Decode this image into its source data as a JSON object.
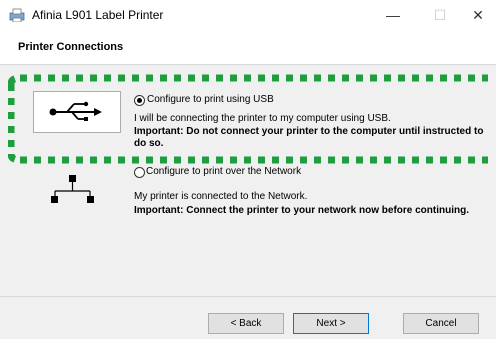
{
  "window": {
    "title": "Afinia L901 Label Printer",
    "controls": {
      "minimize": "—",
      "maximize": "☐",
      "close": "✕"
    }
  },
  "header": {
    "title": "Printer Connections"
  },
  "options": [
    {
      "label": "Configure to print using USB",
      "selected": true,
      "icon": "usb-icon",
      "description": "I will be connecting the printer to my computer using USB.",
      "important": "Important: Do not connect your printer to the computer until instructed to do so."
    },
    {
      "label": "Configure to print over the Network",
      "selected": false,
      "icon": "network-icon",
      "description": "My printer is connected to the Network.",
      "important": "Important: Connect the printer to your network now before continuing."
    }
  ],
  "buttons": {
    "back": "< Back",
    "next": "Next >",
    "cancel": "Cancel"
  },
  "colors": {
    "highlight_dotted": "#1e9e3e",
    "default_button_border": "#0078d7"
  }
}
